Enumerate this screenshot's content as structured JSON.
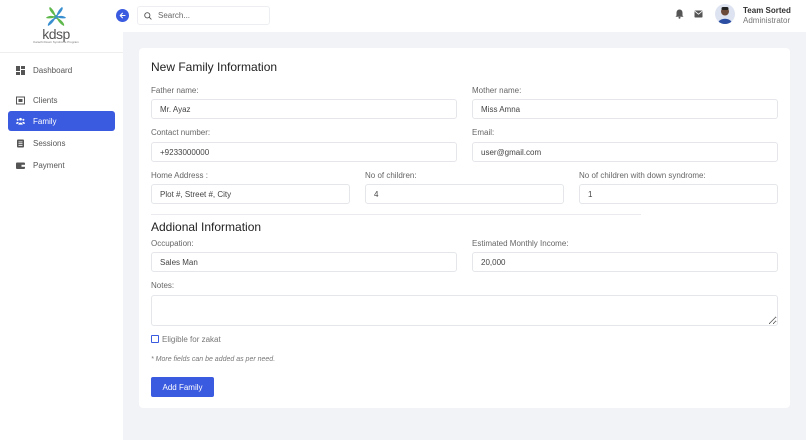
{
  "brand": {
    "logo_text": "kdsp",
    "logo_subtext": "Karachi Down Syndrome Program"
  },
  "sidebar": {
    "items": [
      {
        "label": "Dashboard",
        "icon": "dashboard-icon"
      },
      {
        "label": "Clients",
        "icon": "clients-icon"
      },
      {
        "label": "Family",
        "icon": "family-icon",
        "active": true
      },
      {
        "label": "Sessions",
        "icon": "sessions-icon"
      },
      {
        "label": "Payment",
        "icon": "payment-icon"
      }
    ]
  },
  "topbar": {
    "search_placeholder": "Search...",
    "user_name": "Team Sorted",
    "user_role": "Administrator"
  },
  "form": {
    "title": "New Family Information",
    "father_label": "Father name:",
    "father_value": "Mr. Ayaz",
    "mother_label": "Mother name:",
    "mother_value": "Miss Amna",
    "contact_label": "Contact number:",
    "contact_value": "+9233000000",
    "email_label": "Email:",
    "email_value": "user@gmail.com",
    "address_label": "Home Address :",
    "address_value": "Plot #, Street #, City",
    "children_label": "No of children:",
    "children_value": "4",
    "ds_children_label": "No of children with down syndrome:",
    "ds_children_value": "1",
    "additional_title": "Addional Information",
    "occupation_label": "Occupation:",
    "occupation_value": "Sales Man",
    "income_label": "Estimated Monthly Income:",
    "income_value": "20,000",
    "notes_label": "Notes:",
    "zakat_label": "Eligible for zakat",
    "more_note": "* More fields can be added as per need.",
    "submit_label": "Add Family"
  },
  "colors": {
    "accent": "#3a5ae0",
    "background": "#f2f3f7",
    "card": "#ffffff"
  }
}
